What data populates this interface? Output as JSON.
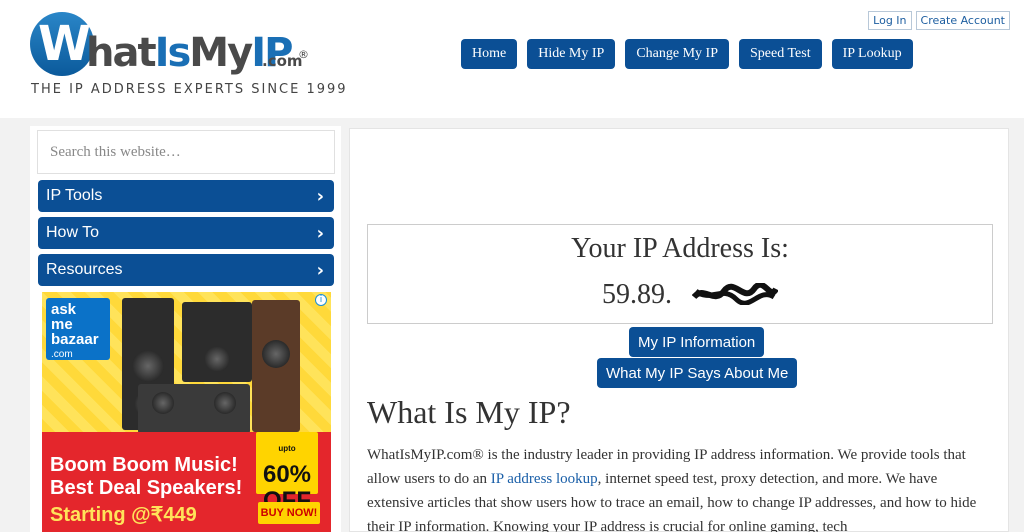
{
  "header": {
    "logo_w": "W",
    "logo_text_a": "hat",
    "logo_text_b": "Is",
    "logo_text_c": "My",
    "logo_text_d": "IP",
    "logo_com": ".com",
    "logo_reg": "®",
    "tagline": "THE IP ADDRESS EXPERTS SINCE 1999",
    "account": {
      "login": "Log In",
      "create": "Create Account"
    },
    "nav": [
      "Home",
      "Hide My IP",
      "Change My IP",
      "Speed Test",
      "IP Lookup"
    ]
  },
  "sidebar": {
    "search_placeholder": "Search this website…",
    "items": [
      {
        "label": "IP Tools",
        "chevron": "›"
      },
      {
        "label": "How To",
        "chevron": "›"
      },
      {
        "label": "Resources",
        "chevron": "›"
      }
    ],
    "ad": {
      "logo_line1": "ask",
      "logo_line2": "me",
      "logo_line3": "bazaar",
      "logo_line4": ".com",
      "info": "i",
      "line1": "Boom Boom Music!",
      "line2": "Best Deal Speakers!",
      "price": "Starting @₹449",
      "off_prefix": "upto",
      "off_value": "60%",
      "off_label": "OFF",
      "buy": "BUY NOW!"
    }
  },
  "main": {
    "ip_heading": "Your IP Address Is:",
    "ip_value": "59.89.",
    "buttons": [
      "My IP Information",
      "What My IP Says About Me"
    ],
    "title": "What Is My IP?",
    "para_before_link": "WhatIsMyIP.com® is the industry leader in providing IP address information. We provide tools that allow users to do an ",
    "para_link": "IP address lookup",
    "para_after_link": ", internet speed test, proxy detection, and more. We have extensive articles that show users how to trace an email, how to change IP addresses, and how to hide their IP information. Knowing your IP address is crucial for online gaming, tech"
  },
  "colors": {
    "primary": "#0b4f95",
    "link": "#1a5fa8",
    "ad_red": "#e4262c",
    "ad_yellow": "#ffe35a"
  }
}
